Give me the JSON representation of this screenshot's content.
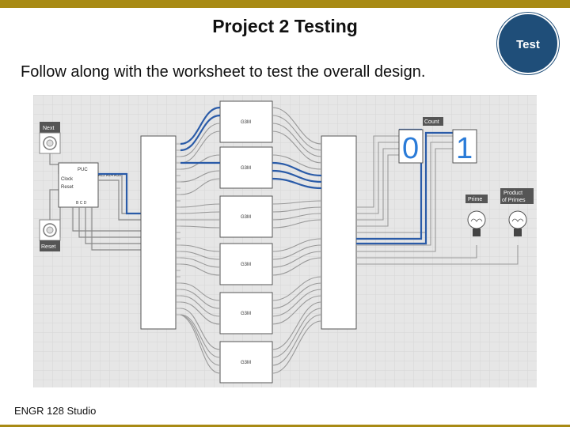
{
  "slide": {
    "title": "Project 2 Testing",
    "badge": "Test",
    "subtitle": "Follow along with the worksheet to test the overall design.",
    "footer": "ENGR 128 Studio"
  },
  "circuit": {
    "next_label": "Next",
    "reset_label": "Reset",
    "count_label": "Count",
    "prime_label": "Prime",
    "product_label_1": "Product",
    "product_label_2": "of Primes",
    "pulse_label": "PUC",
    "clock_label": "Clock",
    "reset_pin_label": "Reset",
    "pulse_outputs": "A12 A24 A36",
    "pulse_pins": "B C D",
    "decoder_label": "G3M",
    "display_left": "0",
    "display_right": "1"
  }
}
